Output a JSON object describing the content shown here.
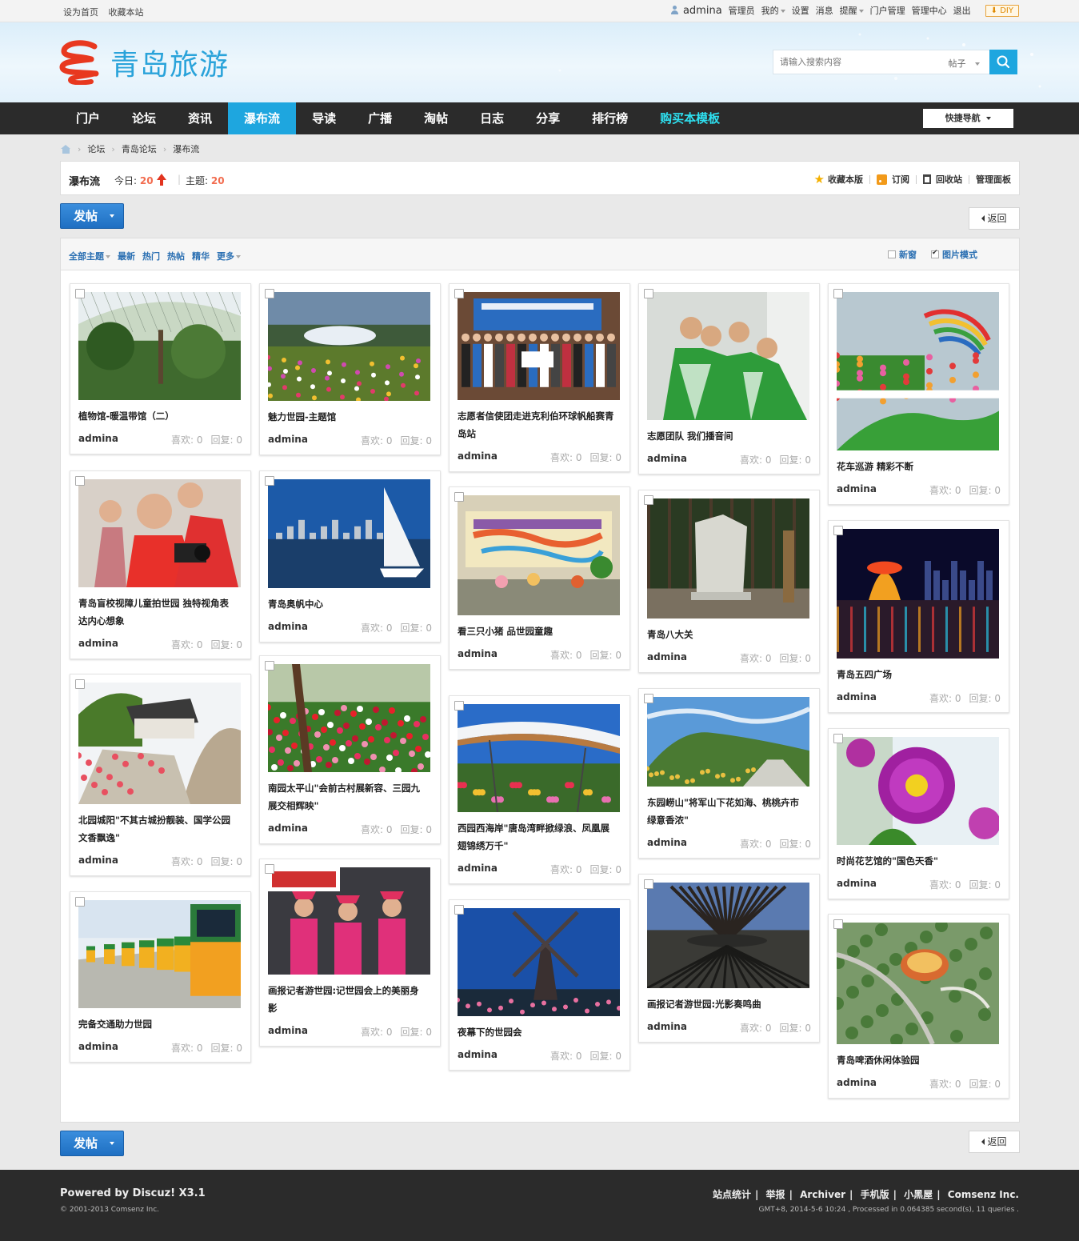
{
  "topbar": {
    "left_links": [
      "设为首页",
      "收藏本站"
    ],
    "username": "admina",
    "right_links": [
      "管理员",
      "我的",
      "设置",
      "消息",
      "提醒",
      "门户管理",
      "管理中心",
      "退出"
    ],
    "diy_label": "DIY"
  },
  "header": {
    "logo_text": "青岛旅游",
    "search_placeholder": "请输入搜索内容",
    "search_type": "帖子"
  },
  "nav": {
    "items": [
      "门户",
      "论坛",
      "资讯",
      "瀑布流",
      "导读",
      "广播",
      "淘帖",
      "日志",
      "分享",
      "排行榜",
      "购买本模板"
    ],
    "active_index": 3,
    "quick_nav_label": "快捷导航"
  },
  "breadcrumb": [
    "论坛",
    "青岛论坛",
    "瀑布流"
  ],
  "forum": {
    "name": "瀑布流",
    "today_label": "今日:",
    "today_count": "20",
    "topics_label": "主题:",
    "topics_count": "20",
    "actions": [
      "收藏本版",
      "订阅",
      "回收站",
      "管理面板"
    ]
  },
  "buttons": {
    "post": "发帖",
    "back": "返回"
  },
  "filters": {
    "items": [
      "全部主题",
      "最新",
      "热门",
      "热帖",
      "精华",
      "更多"
    ],
    "new_window": "新窗",
    "image_mode": "图片模式"
  },
  "card_labels": {
    "likes": "喜欢: 0",
    "replies": "回复: 0"
  },
  "columns": [
    [
      {
        "title_lines": [
          "植物馆-暖温带馆（二）"
        ],
        "author": "admina",
        "img": "greenhouse"
      },
      {
        "title_lines": [
          "青岛盲校视障儿童拍世园 独特视角表",
          "达内心想象"
        ],
        "author": "admina",
        "img": "kids"
      },
      {
        "title_lines": [
          "北园城阳\"不其古城扮靓装、国学公园",
          "文香飘逸\""
        ],
        "author": "admina",
        "img": "garden"
      },
      {
        "title_lines": [
          "完备交通助力世园"
        ],
        "author": "admina",
        "img": "bus"
      }
    ],
    [
      {
        "title_lines": [
          "魅力世园-主题馆"
        ],
        "author": "admina",
        "img": "pavilion"
      },
      {
        "title_lines": [
          "青岛奥帆中心"
        ],
        "author": "admina",
        "img": "sail"
      },
      {
        "title_lines": [
          "南园太平山\"会前古村展新容、三园九",
          "展交相辉映\""
        ],
        "author": "admina",
        "img": "tulips"
      },
      {
        "title_lines": [
          "画报记者游世园:记世园会上的美丽身",
          "影"
        ],
        "author": "admina",
        "img": "hostess"
      }
    ],
    [
      {
        "title_lines": [
          "志愿者信使团走进克利伯环球帆船赛青",
          "岛站"
        ],
        "author": "admina",
        "img": "group"
      },
      {
        "title_lines": [
          "看三只小猪 品世园童趣"
        ],
        "author": "admina",
        "img": "stage"
      },
      {
        "title_lines": [
          "西园西海岸\"唐岛湾畔掀绿浪、凤凰展",
          "翅锦绣万千\""
        ],
        "author": "admina",
        "img": "canopy"
      },
      {
        "title_lines": [
          "夜幕下的世园会"
        ],
        "author": "admina",
        "img": "windmill"
      }
    ],
    [
      {
        "title_lines": [
          "志愿团队 我们播音间"
        ],
        "author": "admina",
        "img": "volunteers"
      },
      {
        "title_lines": [
          "青岛八大关"
        ],
        "author": "admina",
        "img": "stone"
      },
      {
        "title_lines": [
          "东园崂山\"将军山下花如海、桃桃卉市",
          "绿意香浓\""
        ],
        "author": "admina",
        "img": "hill"
      },
      {
        "title_lines": [
          "画报记者游世园:光影奏鸣曲"
        ],
        "author": "admina",
        "img": "sculpture"
      }
    ],
    [
      {
        "title_lines": [
          "花车巡游 精彩不断"
        ],
        "author": "admina",
        "img": "float"
      },
      {
        "title_lines": [
          "青岛五四广场"
        ],
        "author": "admina",
        "img": "night"
      },
      {
        "title_lines": [
          "时尚花艺馆的\"国色天香\""
        ],
        "author": "admina",
        "img": "peony"
      },
      {
        "title_lines": [
          "青岛啤酒休闲体验园"
        ],
        "author": "admina",
        "img": "aerial"
      }
    ]
  ],
  "footer": {
    "powered": "Powered by Discuz! X3.1",
    "copyright": "© 2001-2013 Comsenz Inc.",
    "links": [
      "站点统计",
      "举报",
      "Archiver",
      "手机版",
      "小黑屋",
      "Comsenz Inc."
    ],
    "info": "GMT+8, 2014-5-6 10:24 , Processed in 0.064385 second(s), 11 queries ."
  }
}
